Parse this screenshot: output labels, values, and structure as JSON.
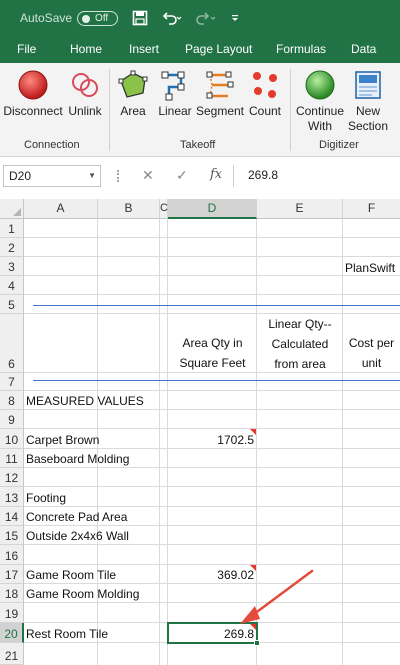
{
  "titlebar": {
    "autosave_label": "AutoSave",
    "autosave_state": "Off",
    "save_icon": "save-icon",
    "undo_icon": "undo-icon",
    "redo_icon": "redo-icon",
    "customize_icon": "customize-toolbar-icon"
  },
  "menu": {
    "tabs": [
      "File",
      "Home",
      "Insert",
      "Page Layout",
      "Formulas",
      "Data"
    ]
  },
  "ribbon": {
    "groups": [
      {
        "label": "Connection",
        "buttons": [
          "Disconnect",
          "Unlink"
        ]
      },
      {
        "label": "Takeoff",
        "buttons": [
          "Area",
          "Linear",
          "Segment",
          "Count"
        ]
      },
      {
        "label": "Digitizer",
        "buttons": [
          "Continue\nWith",
          "New\nSection"
        ]
      }
    ],
    "labels": {
      "disconnect": "Disconnect",
      "unlink": "Unlink",
      "area": "Area",
      "linear": "Linear",
      "segment": "Segment",
      "count": "Count",
      "continue_1": "Continue",
      "continue_2": "With",
      "new_1": "New",
      "new_2": "Section",
      "connection": "Connection",
      "takeoff": "Takeoff",
      "digitizer": "Digitizer"
    },
    "colors": {
      "tab_bar": "#217346",
      "record_red": "#d42b2b",
      "continue_green": "#3aa635",
      "takeoff_blue": "#1f6fb2",
      "segment_orange": "#e37c22"
    }
  },
  "formula_bar": {
    "name_box": "D20",
    "cancel_glyph": "✕",
    "enter_glyph": "✓",
    "fx": "fx",
    "formula": "269.8"
  },
  "sheet": {
    "columns": [
      "A",
      "B",
      "C",
      "D",
      "E",
      "F"
    ],
    "rows": [
      "1",
      "2",
      "3",
      "4",
      "5",
      "6",
      "7",
      "8",
      "9",
      "10",
      "11",
      "12",
      "13",
      "14",
      "15",
      "16",
      "17",
      "18",
      "19",
      "20",
      "21"
    ],
    "selected_cell": "D20",
    "cells": {
      "F3": "PlanSwift",
      "D6_line1": "Area Qty in",
      "D6_line2": "Square Feet",
      "E6_line1": "Linear Qty--",
      "E6_line2": "Calculated",
      "E6_line3": "from area",
      "F6_line1": "Cost per",
      "F6_line2": "unit",
      "A8": "MEASURED VALUES",
      "A10": "Carpet Brown",
      "D10": "1702.5",
      "A11": "Baseboard Molding",
      "A13": "Footing",
      "A14": "Concrete Pad Area",
      "A15": "Outside 2x4x6 Wall",
      "A17": "Game Room Tile",
      "D17": "369.02",
      "A18": "Game Room Molding",
      "A20": "Rest Room Tile",
      "D20": "269.8"
    },
    "annotation_color": "#e34b3c"
  }
}
